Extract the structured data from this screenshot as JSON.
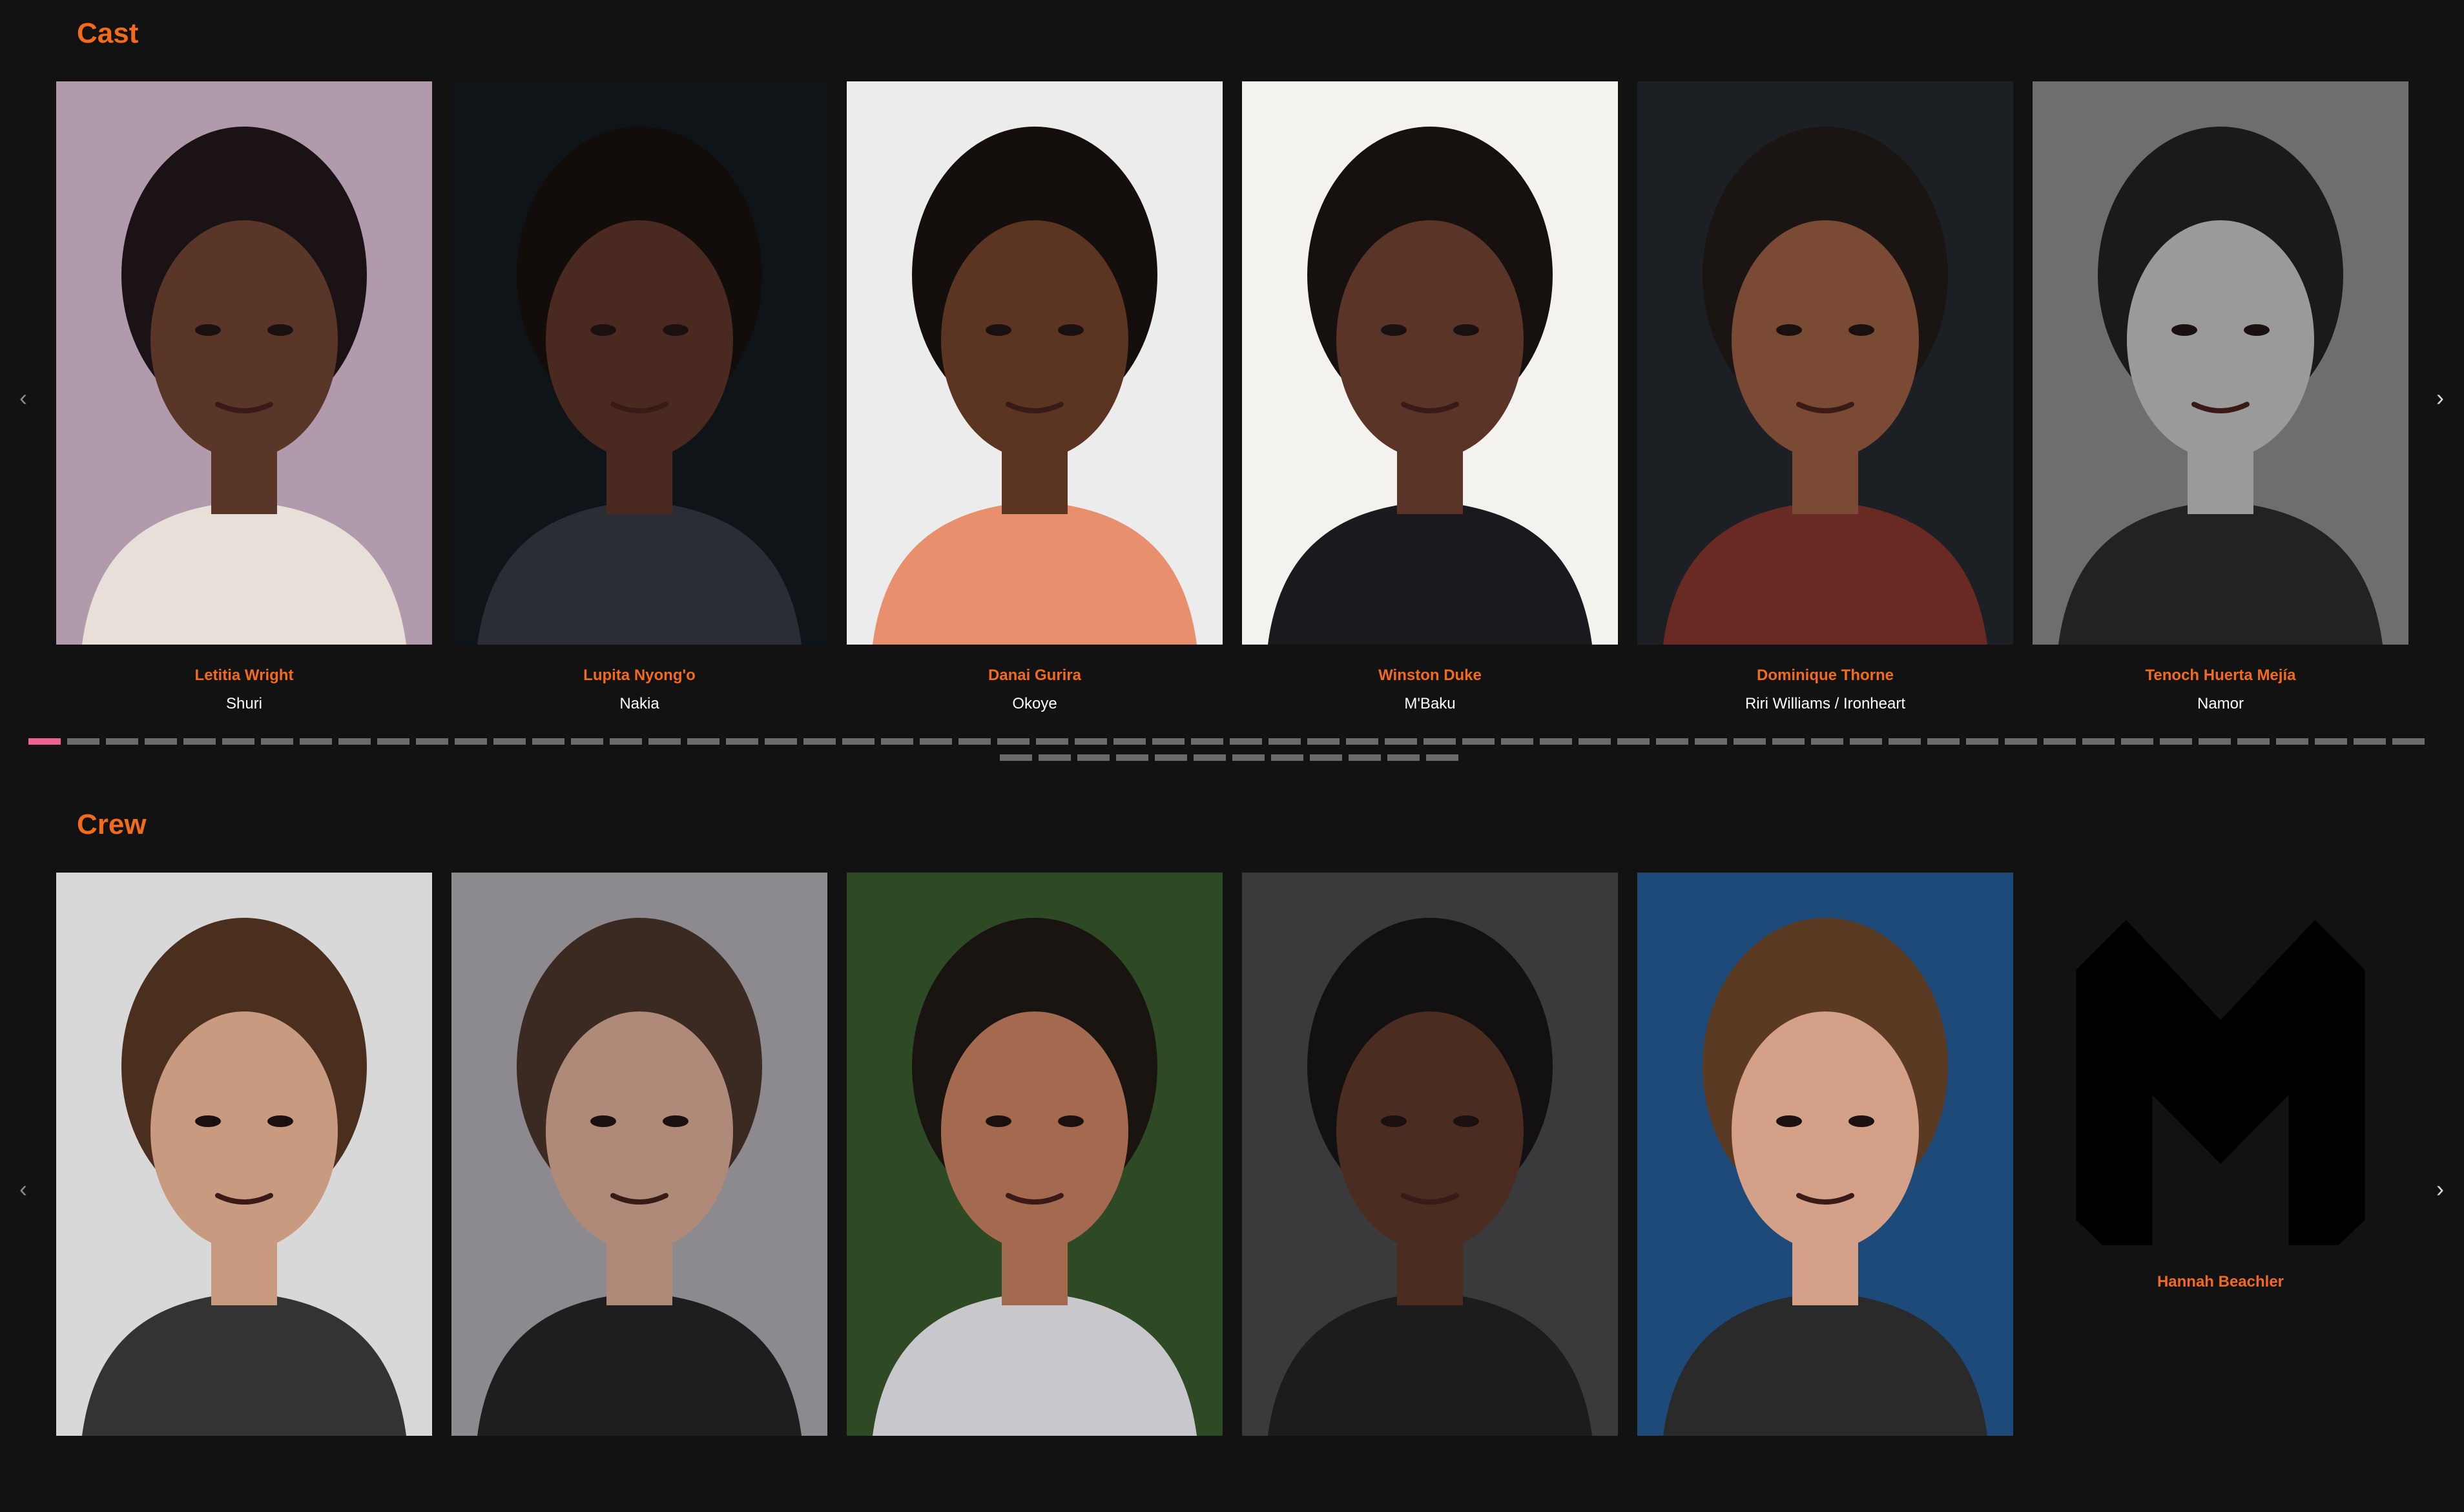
{
  "cast": {
    "title": "Cast",
    "prev_icon": "chevron-left-icon",
    "next_icon": "chevron-right-icon",
    "prev_glyph": "‹",
    "next_glyph": "›",
    "members": [
      {
        "name": "Letitia Wright",
        "role": "Shuri",
        "bg": "#b09aac",
        "skin": "#5a3628",
        "hair": "#1a1214",
        "shirt": "#e8e0d8"
      },
      {
        "name": "Lupita Nyong'o",
        "role": "Nakia",
        "bg": "#0e1418",
        "skin": "#4a2a20",
        "hair": "#120c0a",
        "shirt": "#2a2e34"
      },
      {
        "name": "Danai Gurira",
        "role": "Okoye",
        "bg": "#ececec",
        "skin": "#5c3422",
        "hair": "#140e0c",
        "shirt": "#e8906e"
      },
      {
        "name": "Winston Duke",
        "role": "M'Baku",
        "bg": "#f4f2ee",
        "skin": "#5a3426",
        "hair": "#16100e",
        "shirt": "#1a1a1e"
      },
      {
        "name": "Dominique Thorne",
        "role": "Riri Williams / Ironheart",
        "bg": "#1c2024",
        "skin": "#7a4a34",
        "hair": "#1a1412",
        "shirt": "#6a2a24"
      },
      {
        "name": "Tenoch Huerta Mejía",
        "role": "Namor",
        "bg": "#6e6e6e",
        "skin": "#9a9a9a",
        "hair": "#1a1a1a",
        "shirt": "#222222"
      }
    ],
    "pagination": {
      "total_top_row": 62,
      "total_bottom_row": 12,
      "active_index": 0
    }
  },
  "crew": {
    "title": "Crew",
    "prev_icon": "chevron-left-icon",
    "next_icon": "chevron-right-icon",
    "prev_glyph": "‹",
    "next_glyph": "›",
    "members": [
      {
        "name": "",
        "role": "",
        "bg": "#d8d8d8",
        "skin": "#c89a80",
        "hair": "#4a2e1e",
        "shirt": "#333333"
      },
      {
        "name": "",
        "role": "",
        "bg": "#8c8a8e",
        "skin": "#b08a78",
        "hair": "#3a2a22",
        "shirt": "#1e1e1e"
      },
      {
        "name": "",
        "role": "",
        "bg": "#2e4a24",
        "skin": "#a46a50",
        "hair": "#1a1410",
        "shirt": "#c8c8cc"
      },
      {
        "name": "",
        "role": "",
        "bg": "#3a3a3c",
        "skin": "#4a2c20",
        "hair": "#121010",
        "shirt": "#1c1c1c"
      },
      {
        "name": "",
        "role": "",
        "bg": "#1e4a7a",
        "skin": "#d4a088",
        "hair": "#5a3a22",
        "shirt": "#2a2a2a"
      },
      {
        "name": "Hannah Beachler",
        "role": "",
        "placeholder": true,
        "bg": "#121212"
      }
    ]
  }
}
